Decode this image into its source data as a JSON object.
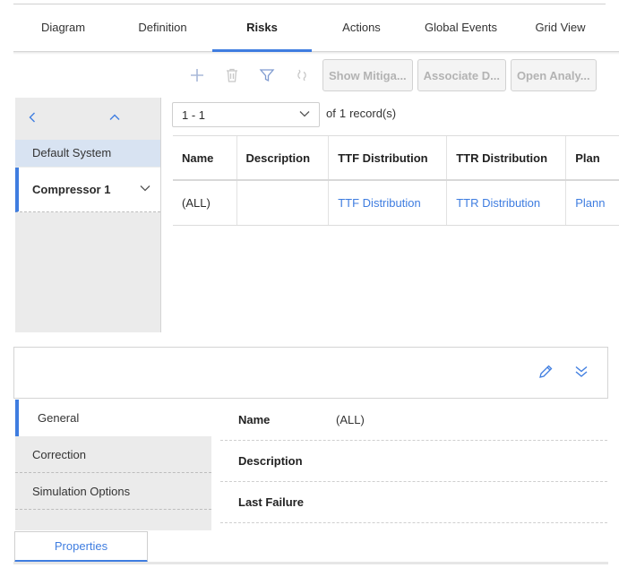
{
  "tabs": [
    "Diagram",
    "Definition",
    "Risks",
    "Actions",
    "Global Events",
    "Grid View"
  ],
  "active_tab": "Risks",
  "toolbar": {
    "icons": [
      "plus-icon",
      "trash-icon",
      "filter-icon",
      "link-icon"
    ],
    "buttons": [
      "Show Mitiga...",
      "Associate D...",
      "Open Analy..."
    ]
  },
  "nav": {
    "default_system": "Default System",
    "selected_item": "Compressor 1"
  },
  "pager": {
    "range": "1 - 1",
    "of_label": "of",
    "count": "1",
    "records_label": "record(s)"
  },
  "grid": {
    "columns": [
      "Name",
      "Description",
      "TTF Distribution",
      "TTR Distribution",
      "Plan"
    ],
    "rows": [
      [
        "(ALL)",
        "",
        "TTF Distribution",
        "TTR Distribution",
        "Plann"
      ]
    ]
  },
  "detail": {
    "side_tabs": [
      "General",
      "Correction",
      "Simulation Options"
    ],
    "fields": [
      {
        "label": "Name",
        "value": "(ALL)"
      },
      {
        "label": "Description",
        "value": ""
      },
      {
        "label": "Last Failure",
        "value": ""
      }
    ]
  },
  "bottom_tab": "Properties",
  "colors": {
    "accent": "#3f7de0",
    "panel": "#ebebeb",
    "selected": "#d8e3f2"
  }
}
